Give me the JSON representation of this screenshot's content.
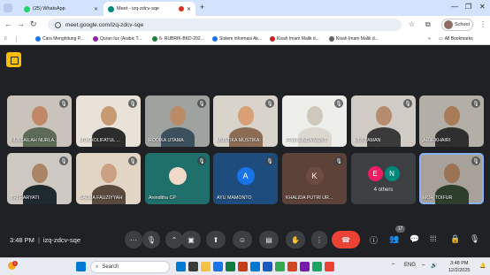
{
  "browser": {
    "tabs": [
      {
        "title": "(25) WhatsApp",
        "fav_color": "#25d366"
      },
      {
        "title": "Meet - izq-zdcv-sqe",
        "fav_color": "#00897b"
      }
    ],
    "url": "meet.google.com/izq-zdcv-sqe",
    "profile_label": "School",
    "bookmarks": [
      {
        "label": "Cara Menghitung P...",
        "color": "#1a73e8"
      },
      {
        "label": "Quran Iuz (Arabic T...",
        "color": "#8e24aa"
      },
      {
        "label": "6- RUBRIK-BKD-202...",
        "color": "#188038"
      },
      {
        "label": "Sistem informasi Ak...",
        "color": "#1a73e8"
      },
      {
        "label": "Kisah Imam Malik d...",
        "color": "#c5221f"
      },
      {
        "label": "Kisah Imam Malik d...",
        "color": "#5f6368"
      }
    ],
    "all_bookmarks": "All Bookmarks"
  },
  "meet": {
    "time": "3:48 PM",
    "meeting_code": "izq-zdcv-sqe",
    "participant_count": "17",
    "tiles_row1": [
      {
        "name": "NURLAILAH NURLA...",
        "kind": "video",
        "bg": "#c9c3bb",
        "skin": "#c08866",
        "cloth": "#5d6b56"
      },
      {
        "name": "MUKHOLIFATUL ...",
        "kind": "video",
        "bg": "#e8e2d8",
        "skin": "#c69a72",
        "cloth": "#2c2c2c"
      },
      {
        "name": "RODIKA UTAMA",
        "kind": "video",
        "bg": "#9ea3a0",
        "skin": "#b98b67",
        "cloth": "#3c4f5c"
      },
      {
        "name": "MUSTIKA MUSTIKA",
        "kind": "video",
        "bg": "#d8d4cc",
        "skin": "#d9a076",
        "cloth": "#8c6d54"
      },
      {
        "name": "FRMI LINDA MUKTI",
        "kind": "video",
        "bg": "#eeeeea",
        "skin": "#cfc8bd",
        "cloth": "#dcd7cf"
      },
      {
        "name": "RUSTAMAN",
        "kind": "video",
        "bg": "#d0ccc5",
        "skin": "#b58c6d",
        "cloth": "#3a3a3a"
      },
      {
        "name": "ARIF KHAIRI",
        "kind": "video",
        "bg": "#b3aea6",
        "skin": "#a77a58",
        "cloth": "#2f2f2f"
      }
    ],
    "tiles_row2": [
      {
        "name": "TRI HARYATI",
        "kind": "video",
        "bg": "#cdc9c2",
        "skin": "#a98465",
        "cloth": "#1f2a2f"
      },
      {
        "name": "SALMA FAUZIYYAH",
        "kind": "video",
        "bg": "#e2d5c5",
        "skin": "#caa283",
        "cloth": "#5a4a3e"
      },
      {
        "name": "Aninditha CP",
        "kind": "avatar",
        "bg": "#1f6f6b",
        "avatar_bg": "#f1d9c9",
        "letter": ""
      },
      {
        "name": "AYU MAMONTO",
        "kind": "avatar",
        "bg": "#1e4c7c",
        "avatar_bg": "#1a73e8",
        "letter": "A"
      },
      {
        "name": "KHALIDA PUTRI UR...",
        "kind": "avatar",
        "bg": "#5c4238",
        "avatar_bg": "#6d4c41",
        "letter": "K"
      },
      {
        "name": "",
        "kind": "others",
        "bg": "#3c4043",
        "others_label": "4 others",
        "others": [
          {
            "letter": "E",
            "color": "#e91e63"
          },
          {
            "letter": "N",
            "color": "#00897b"
          }
        ]
      },
      {
        "name": "MOH TOIFUR",
        "kind": "video",
        "bg": "#a7a199",
        "skin": "#9a7254",
        "cloth": "#2d3e2c",
        "active": true
      }
    ]
  },
  "taskbar": {
    "search_placeholder": "Search",
    "language": "ENG",
    "clock_time": "3:48 PM",
    "clock_date": "12/2/2025",
    "weather_badge": "1",
    "apps": [
      "#0078d4",
      "#3a3a3a",
      "#f6c343",
      "#1a73e8",
      "#107c41",
      "#c43e1c",
      "#0078d4",
      "#185abd",
      "#34a853",
      "#d24726",
      "#7719aa",
      "#1da462",
      "#ea4335"
    ]
  }
}
